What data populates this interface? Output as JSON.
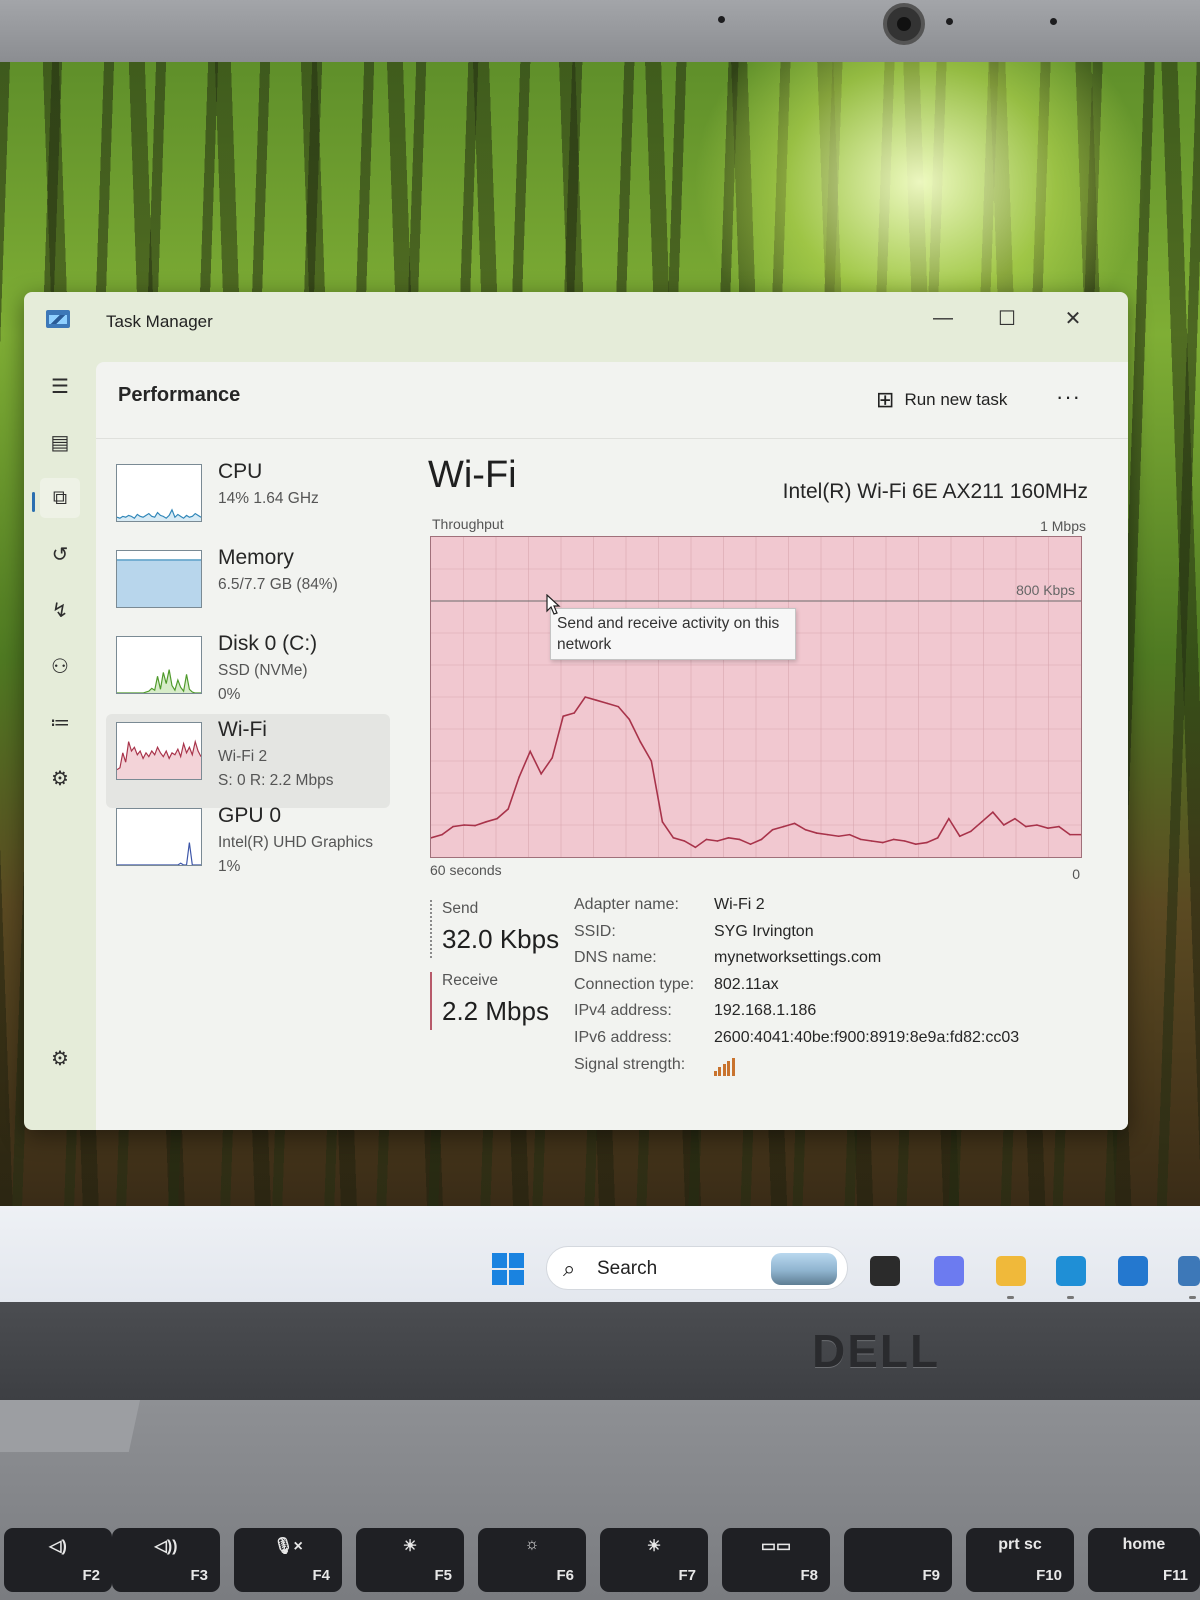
{
  "window": {
    "title": "Task Manager",
    "minimize_glyph": "—",
    "maximize_glyph": "☐",
    "close_glyph": "✕"
  },
  "nav": {
    "items": [
      {
        "name": "hamburger-menu-icon",
        "glyph": "☰"
      },
      {
        "name": "processes-icon",
        "glyph": "▤"
      },
      {
        "name": "performance-icon",
        "glyph": "⧉"
      },
      {
        "name": "app-history-icon",
        "glyph": "↺"
      },
      {
        "name": "startup-apps-icon",
        "glyph": "↯"
      },
      {
        "name": "users-icon",
        "glyph": "⚇"
      },
      {
        "name": "details-icon",
        "glyph": "≔"
      },
      {
        "name": "services-icon",
        "glyph": "⚙"
      }
    ],
    "settings_glyph": "⚙"
  },
  "header": {
    "title": "Performance",
    "run_new_task": "Run new task",
    "more_glyph": "···"
  },
  "sidebar": {
    "items": [
      {
        "name": "CPU",
        "sub1": "14%  1.64 GHz",
        "sub2": "",
        "color": "#2f86b8",
        "fill": "#d8ebf5",
        "selected": false,
        "graph": [
          4,
          3,
          5,
          4,
          6,
          5,
          3,
          7,
          5,
          4,
          6,
          8,
          5,
          4,
          9,
          6,
          5,
          3,
          6,
          12,
          4,
          7,
          5,
          3,
          6,
          4,
          5,
          8,
          6,
          4
        ]
      },
      {
        "name": "Memory",
        "sub1": "6.5/7.7 GB (84%)",
        "sub2": "",
        "color": "#2f86b8",
        "fill": "#b8d6ec",
        "selected": false,
        "graph": [
          84,
          84,
          84,
          84,
          84,
          84,
          84,
          84,
          84,
          84,
          84,
          84,
          84,
          84,
          84,
          84,
          84,
          84,
          84,
          84,
          84,
          84,
          84,
          84,
          84,
          84,
          84,
          84,
          84,
          84
        ]
      },
      {
        "name": "Disk 0 (C:)",
        "sub1": "SSD (NVMe)",
        "sub2": "0%",
        "color": "#4f9a2b",
        "fill": "#d7ecc9",
        "selected": false,
        "graph": [
          0,
          0,
          0,
          0,
          0,
          0,
          0,
          0,
          0,
          0,
          1,
          2,
          5,
          3,
          18,
          4,
          22,
          10,
          25,
          8,
          3,
          14,
          6,
          2,
          20,
          4,
          1,
          0,
          0,
          0
        ]
      },
      {
        "name": "Wi-Fi",
        "sub1": "Wi-Fi 2",
        "sub2": "S: 0 R: 2.2 Mbps",
        "color": "#a8334a",
        "fill": "#f3d3d8",
        "selected": true,
        "graph": [
          10,
          12,
          28,
          18,
          40,
          30,
          34,
          26,
          30,
          22,
          28,
          24,
          30,
          26,
          34,
          28,
          24,
          30,
          22,
          28,
          26,
          32,
          24,
          38,
          28,
          34,
          26,
          40,
          30,
          24
        ]
      },
      {
        "name": "GPU 0",
        "sub1": "Intel(R) UHD Graphics",
        "sub2": "1%",
        "color": "#3c55a8",
        "fill": "#ffffff",
        "selected": false,
        "graph": [
          0,
          0,
          0,
          0,
          0,
          0,
          0,
          0,
          0,
          0,
          0,
          0,
          0,
          0,
          0,
          0,
          0,
          0,
          0,
          0,
          0,
          0,
          2,
          0,
          0,
          24,
          0,
          0,
          0,
          0
        ]
      }
    ]
  },
  "main": {
    "title": "Wi-Fi",
    "adapter_description": "Intel(R) Wi-Fi 6E AX211 160MHz",
    "graph_label": "Throughput",
    "graph_max_label": "1 Mbps",
    "graph_time_label": "60 seconds",
    "graph_zero_label": "0",
    "reference_line_label": "800 Kbps",
    "tooltip": "Send and receive activity on this network",
    "send_label": "Send",
    "send_value": "32.0 Kbps",
    "receive_label": "Receive",
    "receive_value": "2.2 Mbps",
    "properties": [
      {
        "key": "Adapter name:",
        "value": "Wi-Fi 2"
      },
      {
        "key": "SSID:",
        "value": "SYG Irvington"
      },
      {
        "key": "DNS name:",
        "value": "mynetworksettings.com"
      },
      {
        "key": "Connection type:",
        "value": "802.11ax"
      },
      {
        "key": "IPv4 address:",
        "value": "192.168.1.186"
      },
      {
        "key": "IPv6 address:",
        "value": "2600:4041:40be:f900:8919:8e9a:fd82:cc03"
      },
      {
        "key": "Signal strength:",
        "value": ""
      }
    ],
    "signal_bars": 5,
    "colors": {
      "receive_line": "#a8334a",
      "graph_fill": "#f1c8d0",
      "grid": "#d9a6b0",
      "signal": "#c9732e"
    }
  },
  "chart_data": {
    "type": "line",
    "ylim": [
      0,
      1000
    ],
    "ylabel": "Throughput",
    "reference_line": 800,
    "series": [
      {
        "values": [
          60,
          70,
          95,
          100,
          98,
          110,
          120,
          150,
          250,
          330,
          260,
          310,
          440,
          450,
          500,
          490,
          480,
          470,
          430,
          360,
          300,
          110,
          60,
          50,
          30,
          55,
          50,
          60,
          55,
          40,
          55,
          85,
          95,
          105,
          85,
          75,
          70,
          65,
          70,
          55,
          50,
          45,
          55,
          50,
          40,
          45,
          60,
          120,
          65,
          80,
          110,
          140,
          100,
          120,
          95,
          100,
          90,
          95,
          70,
          70
        ]
      }
    ]
  },
  "taskbar": {
    "search_text": "Search",
    "search_icon": "⌕",
    "apps": [
      {
        "name": "task-view-icon",
        "color": "#2b2b2b"
      },
      {
        "name": "copilot-icon",
        "color": "#6c7bf0"
      },
      {
        "name": "file-explorer-icon",
        "color": "#f0b93a"
      },
      {
        "name": "edge-icon",
        "color": "#1f8fd6"
      },
      {
        "name": "store-icon",
        "color": "#2478cf"
      },
      {
        "name": "task-manager-taskbar-icon",
        "color": "#3d78b8"
      }
    ]
  },
  "device": {
    "brand": "DELL",
    "keys": [
      {
        "top": "◁)",
        "fn": "F2"
      },
      {
        "top": "◁))",
        "fn": "F3"
      },
      {
        "top": "🎙×",
        "fn": "F4"
      },
      {
        "top": "☀",
        "fn": "F5"
      },
      {
        "top": "☼",
        "fn": "F6"
      },
      {
        "top": "☀",
        "fn": "F7"
      },
      {
        "top": "▭▭",
        "fn": "F8"
      },
      {
        "top": "",
        "fn": "F9"
      },
      {
        "top": "prt sc",
        "fn": "F10"
      },
      {
        "top": "home",
        "fn": "F11"
      }
    ]
  }
}
